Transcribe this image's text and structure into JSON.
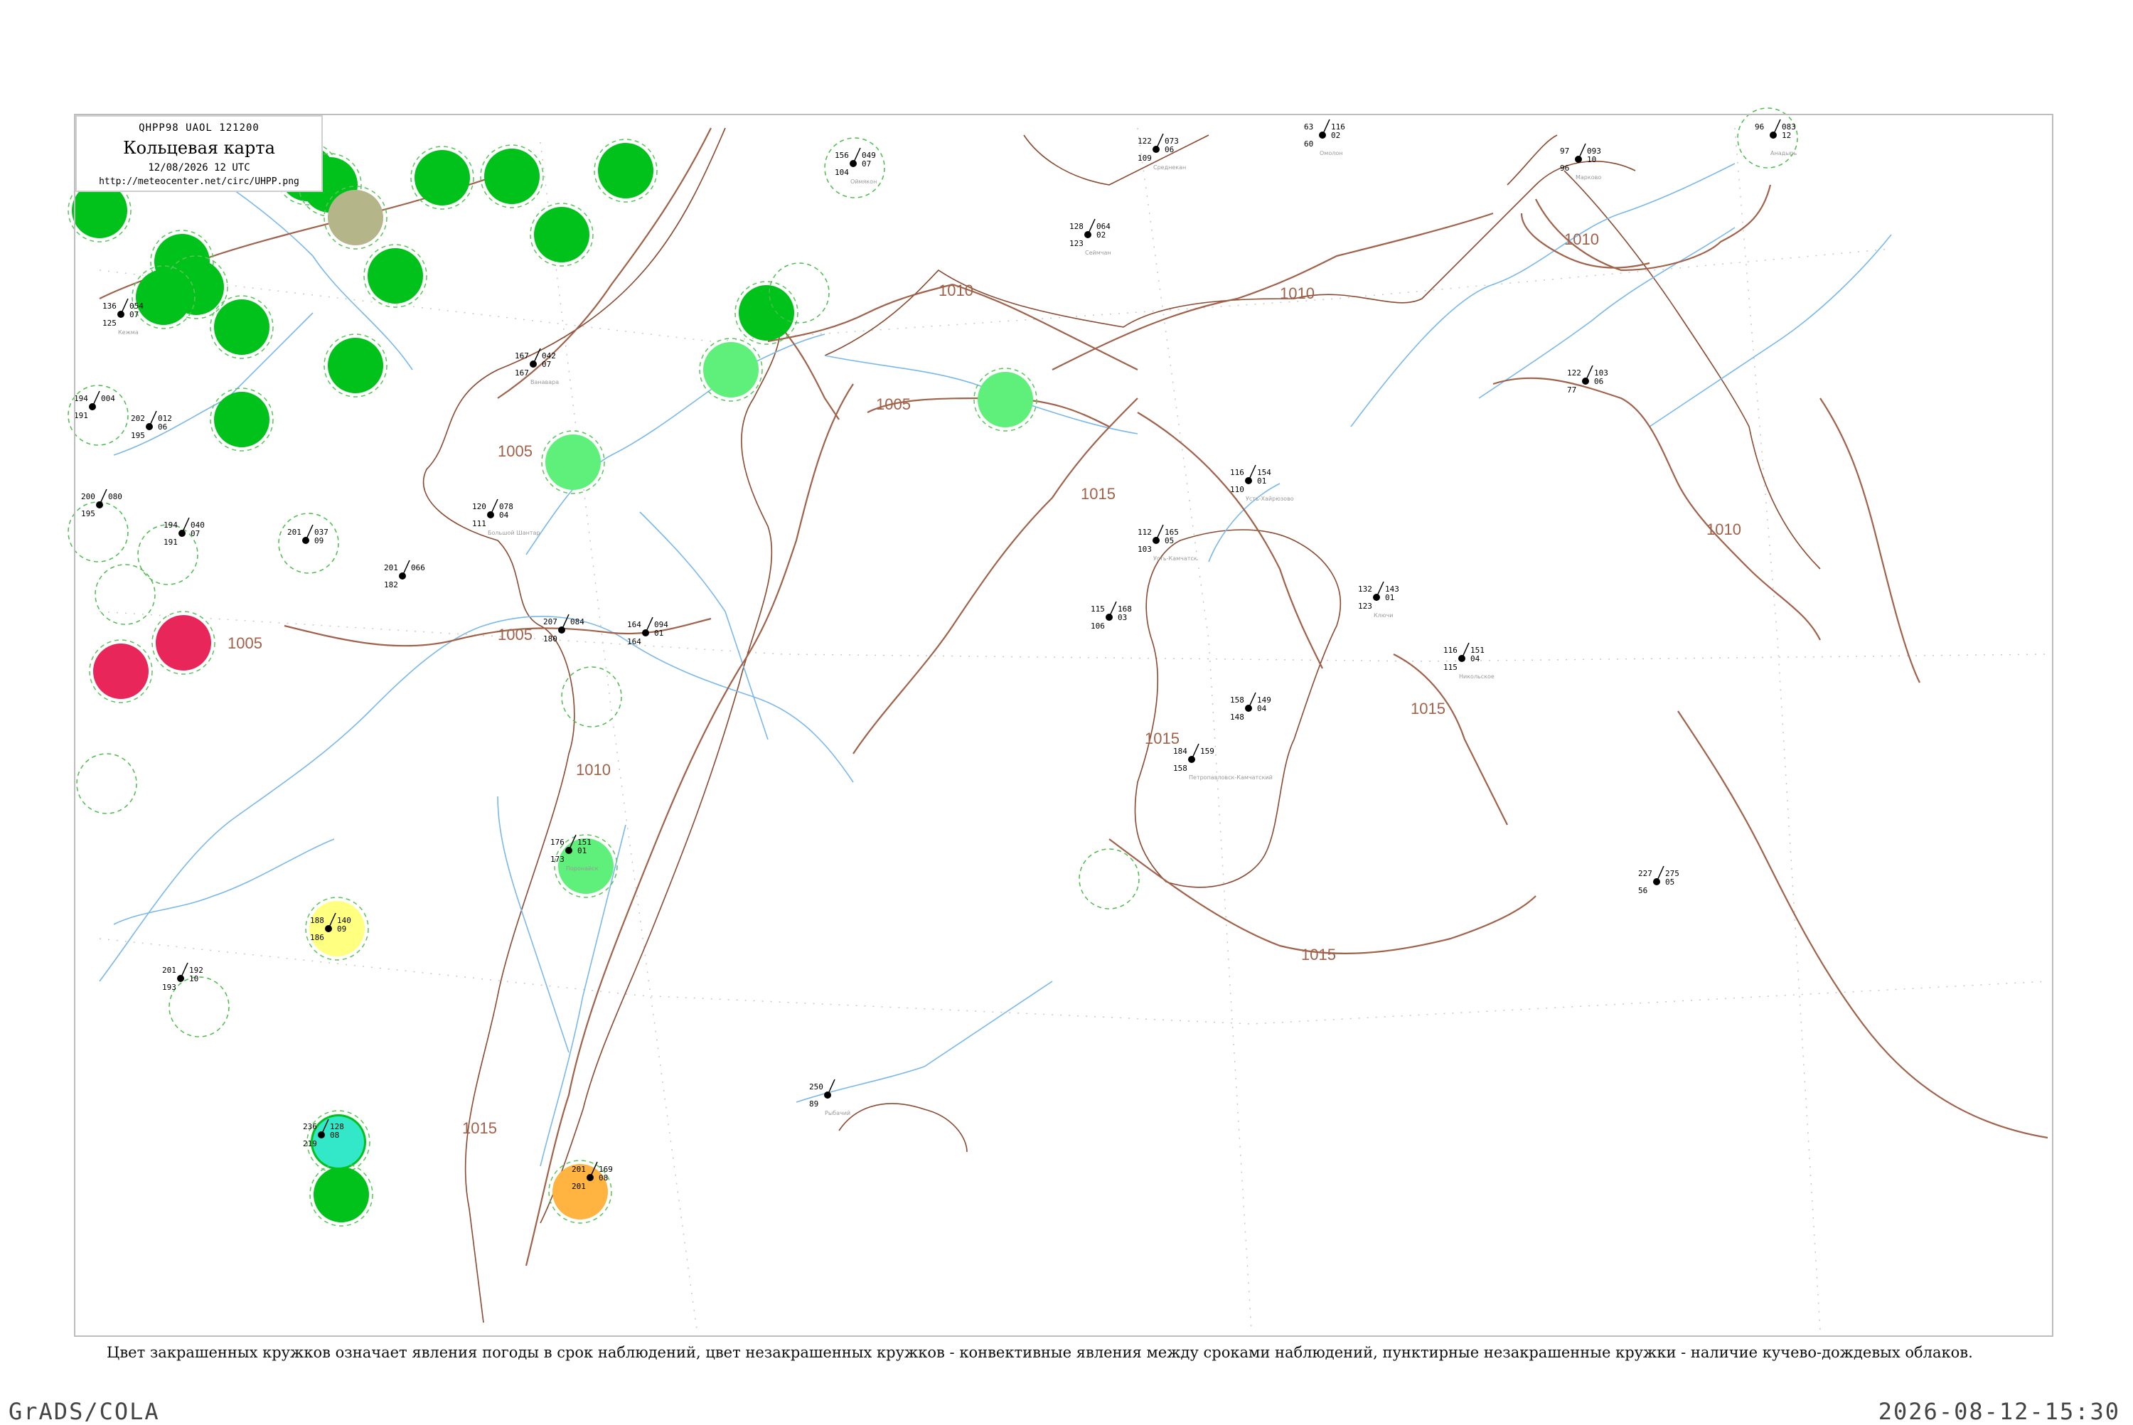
{
  "header": {
    "code": "QHPP98  UAOL  121200",
    "title": "Кольцевая карта",
    "datetime": "12/08/2026 12 UTC",
    "url": "http://meteocenter.net/circ/UHPP.png"
  },
  "caption": "Цвет закрашенных кружков означает явления погоды в срок наблюдений, цвет незакрашенных кружков - конвективные явления между сроками наблюдений, пунктирные незакрашенные кружки - наличие кучево-дождевых облаков.",
  "footer": {
    "left": "GrADS/COLA",
    "right": "2026-08-12-15:30"
  },
  "colors": {
    "isobar": "#a0624a",
    "river": "#7ab8ea",
    "coast": "#8a4a30",
    "rain_green": "#00c21a",
    "light_rain": "#5ef07a",
    "thunder_red": "#e8265a",
    "fog_yellow": "#ffff80",
    "dust_khaki": "#b5b58a",
    "orange": "#ffb340",
    "cyan": "#33e8c8"
  },
  "isobars": [
    "1005",
    "1005",
    "1005",
    "1010",
    "1010",
    "1010",
    "1010",
    "1015",
    "1015",
    "1015",
    "1015",
    "1015",
    "1005",
    "1010"
  ],
  "stations": [
    {
      "n1": "156",
      "n2": "104",
      "v1": "049",
      "v2": "07",
      "name": "Оймякон"
    },
    {
      "n1": "122",
      "n2": "109",
      "v1": "073",
      "v2": "06",
      "name": "Среднекан"
    },
    {
      "n1": "63",
      "n2": "60",
      "v1": "116",
      "v2": "02",
      "name": "Омолон"
    },
    {
      "n1": "97",
      "n2": "96",
      "v1": "093",
      "v2": "10",
      "name": "Марково"
    },
    {
      "n1": "96",
      "n2": "",
      "v1": "083",
      "v2": "12",
      "name": "Анадырь"
    },
    {
      "n1": "128",
      "n2": "123",
      "v1": "064",
      "v2": "02",
      "name": "Сеймчан"
    },
    {
      "n1": "167",
      "n2": "167",
      "v1": "042",
      "v2": "07",
      "name": "Ванавара"
    },
    {
      "n1": "136",
      "n2": "125",
      "v1": "054",
      "v2": "07",
      "name": "Кежма"
    },
    {
      "n1": "194",
      "n2": "191",
      "v1": "004",
      "v2": "",
      "name": ""
    },
    {
      "n1": "202",
      "n2": "195",
      "v1": "012",
      "v2": "06",
      "name": ""
    },
    {
      "n1": "200",
      "n2": "195",
      "v1": "080",
      "v2": "",
      "name": ""
    },
    {
      "n1": "194",
      "n2": "191",
      "v1": "040",
      "v2": "07",
      "name": ""
    },
    {
      "n1": "201",
      "n2": "",
      "v1": "037",
      "v2": "09",
      "name": ""
    },
    {
      "n1": "120",
      "n2": "111",
      "v1": "078",
      "v2": "04",
      "name": "Большой Шантар"
    },
    {
      "n1": "201",
      "n2": "182",
      "v1": "066",
      "v2": "",
      "name": ""
    },
    {
      "n1": "207",
      "n2": "180",
      "v1": "084",
      "v2": "",
      "name": ""
    },
    {
      "n1": "164",
      "n2": "164",
      "v1": "094",
      "v2": "01",
      "name": ""
    },
    {
      "n1": "116",
      "n2": "110",
      "v1": "154",
      "v2": "01",
      "name": "Усть-Хайрюзово"
    },
    {
      "n1": "112",
      "n2": "103",
      "v1": "165",
      "v2": "05",
      "name": "Усть-Камчатск"
    },
    {
      "n1": "132",
      "n2": "123",
      "v1": "143",
      "v2": "01",
      "name": "Ключи"
    },
    {
      "n1": "115",
      "n2": "106",
      "v1": "168",
      "v2": "03",
      "name": ""
    },
    {
      "n1": "116",
      "n2": "115",
      "v1": "151",
      "v2": "04",
      "name": "Никольское"
    },
    {
      "n1": "122",
      "n2": "77",
      "v1": "103",
      "v2": "06",
      "name": ""
    },
    {
      "n1": "158",
      "n2": "148",
      "v1": "149",
      "v2": "04",
      "name": ""
    },
    {
      "n1": "184",
      "n2": "158",
      "v1": "159",
      "v2": "",
      "name": "Петропавловск-Камчатский"
    },
    {
      "n1": "227",
      "n2": "56",
      "v1": "275",
      "v2": "05",
      "name": ""
    },
    {
      "n1": "250",
      "n2": "89",
      "v1": "",
      "v2": "",
      "name": "Рыбачий"
    },
    {
      "n1": "188",
      "n2": "186",
      "v1": "140",
      "v2": "09",
      "name": ""
    },
    {
      "n1": "201",
      "n2": "193",
      "v1": "192",
      "v2": "10",
      "name": ""
    },
    {
      "n1": "176",
      "n2": "173",
      "v1": "151",
      "v2": "01",
      "name": "Поронайск"
    },
    {
      "n1": "201",
      "n2": "201",
      "v1": "169",
      "v2": "08",
      "name": ""
    },
    {
      "n1": "236",
      "n2": "219",
      "v1": "128",
      "v2": "08",
      "name": ""
    }
  ]
}
